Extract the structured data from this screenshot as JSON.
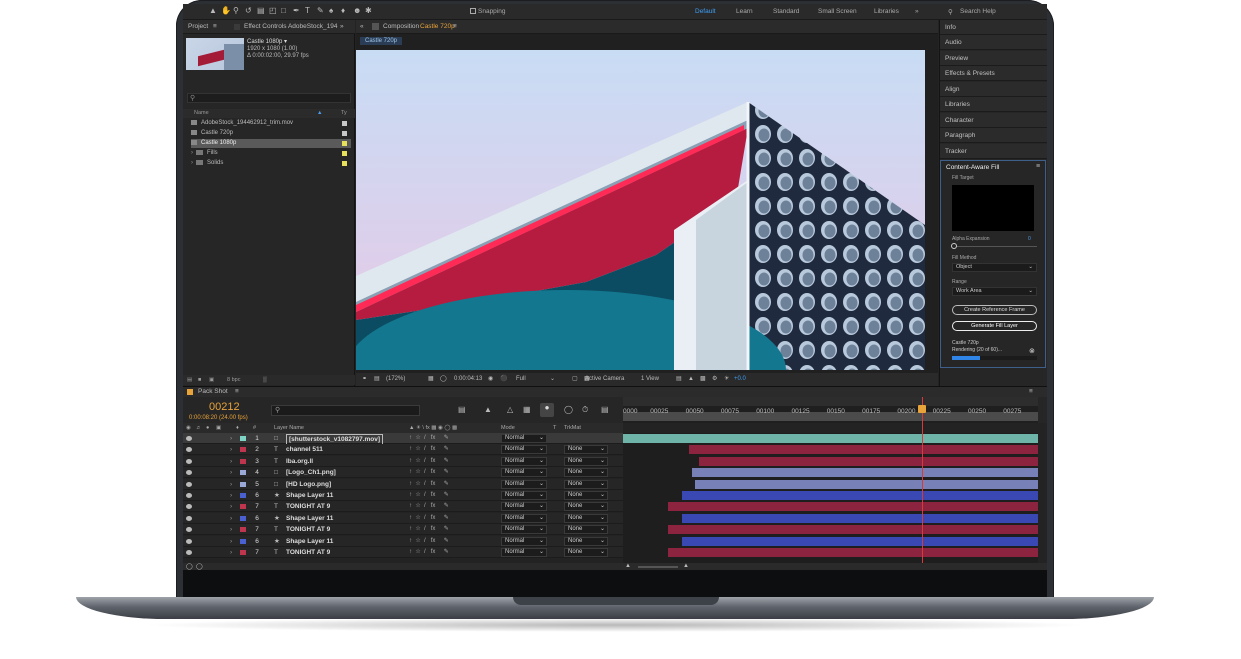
{
  "topbar": {
    "snapping": "Snapping",
    "workspaces": [
      "Default",
      "Learn",
      "Standard",
      "Small Screen",
      "Libraries"
    ],
    "search_help": "Search Help"
  },
  "project": {
    "tab": "Project",
    "effect_controls": "Effect Controls AdobeStock_194",
    "selected_name": "Castle 1080p ▾",
    "meta1": "1920 x 1080 (1.00)",
    "meta2": "Δ 0:00:02:00, 29.97 fps",
    "col_name": "Name",
    "col_type": "Ty",
    "items": [
      {
        "name": "AdobeStock_194462912_trim.mov",
        "kind": "file",
        "color": "#c8c8c8"
      },
      {
        "name": "Castle 720p",
        "kind": "comp",
        "color": "#c8c8c8"
      },
      {
        "name": "Castle 1080p",
        "kind": "comp",
        "color": "#e6e05a",
        "selected": true
      },
      {
        "name": "Fills",
        "kind": "folder",
        "color": "#e6e05a"
      },
      {
        "name": "Solids",
        "kind": "folder",
        "color": "#e6e05a"
      }
    ],
    "bpc": "8 bpc"
  },
  "composition": {
    "tab": "Composition",
    "comp_name": "Castle 720p",
    "viewer_tab": "Castle 720p",
    "zoom": "(172%)",
    "time": "0:00:04:13",
    "resolution": "Full",
    "camera": "Active Camera",
    "view": "1 View",
    "exposure": "+0.0"
  },
  "right_panel": {
    "items": [
      "Info",
      "Audio",
      "Preview",
      "Effects & Presets",
      "Align",
      "Libraries",
      "Character",
      "Paragraph",
      "Tracker"
    ],
    "caf": {
      "title": "Content-Aware Fill",
      "fill_target": "Fill Target",
      "alpha_expansion": "Alpha Expansion",
      "alpha_value": "0",
      "fill_method": "Fill Method",
      "fill_method_value": "Object",
      "range": "Range",
      "range_value": "Work Area",
      "create_ref": "Create Reference Frame",
      "generate": "Generate Fill Layer",
      "status_name": "Castle 720p",
      "status_text": "Rendering (20 of 60)...",
      "progress": 0.33
    }
  },
  "timeline": {
    "tab": "Pack Shot",
    "timecode": "00212",
    "timecode_sub": "0:00:08:20 (24.00 fps)",
    "ticks": [
      "0000",
      "00025",
      "00050",
      "00075",
      "00100",
      "00125",
      "00150",
      "00175",
      "00200",
      "00225",
      "00250",
      "00275"
    ],
    "cti_frame": 212,
    "col_layer_name": "Layer Name",
    "col_mode": "Mode",
    "col_t": "T",
    "col_trkmat": "TrkMat",
    "layers": [
      {
        "num": "1",
        "type": "file",
        "name": "[shutterstock_v1082797.mov]",
        "mode": "Normal",
        "trkmat": "",
        "label": "#7fd3c4",
        "bar_start": 0,
        "bar_color": "#6fb4a8",
        "selected": true
      },
      {
        "num": "2",
        "type": "T",
        "name": "channel 511",
        "mode": "Normal",
        "trkmat": "None",
        "label": "#c0354e",
        "bar_start": 47,
        "bar_color": "#8c2440"
      },
      {
        "num": "3",
        "type": "T",
        "name": "lba.org.ll",
        "mode": "Normal",
        "trkmat": "None",
        "label": "#c0354e",
        "bar_start": 54,
        "bar_color": "#8c2440"
      },
      {
        "num": "4",
        "type": "file",
        "name": "[Logo_Ch1.png]",
        "mode": "Normal",
        "trkmat": "None",
        "label": "#9aa8d8",
        "bar_start": 49,
        "bar_color": "#7880b8"
      },
      {
        "num": "5",
        "type": "file",
        "name": "[HD Logo.png]",
        "mode": "Normal",
        "trkmat": "None",
        "label": "#9aa8d8",
        "bar_start": 51,
        "bar_color": "#7880b8"
      },
      {
        "num": "6",
        "type": "star",
        "name": "Shape Layer 11",
        "mode": "Normal",
        "trkmat": "None",
        "label": "#4a5fd0",
        "bar_start": 42,
        "bar_color": "#3a48b4"
      },
      {
        "num": "7",
        "type": "T",
        "name": "TONIGHT AT 9",
        "mode": "Normal",
        "trkmat": "None",
        "label": "#c0354e",
        "bar_start": 32,
        "bar_color": "#8c2440"
      },
      {
        "num": "6",
        "type": "star",
        "name": "Shape Layer 11",
        "mode": "Normal",
        "trkmat": "None",
        "label": "#4a5fd0",
        "bar_start": 42,
        "bar_color": "#3a48b4"
      },
      {
        "num": "7",
        "type": "T",
        "name": "TONIGHT AT 9",
        "mode": "Normal",
        "trkmat": "None",
        "label": "#c0354e",
        "bar_start": 32,
        "bar_color": "#8c2440"
      },
      {
        "num": "6",
        "type": "star",
        "name": "Shape Layer 11",
        "mode": "Normal",
        "trkmat": "None",
        "label": "#4a5fd0",
        "bar_start": 42,
        "bar_color": "#3a48b4"
      },
      {
        "num": "7",
        "type": "T",
        "name": "TONIGHT AT 9",
        "mode": "Normal",
        "trkmat": "None",
        "label": "#c0354e",
        "bar_start": 32,
        "bar_color": "#8c2440"
      }
    ]
  }
}
